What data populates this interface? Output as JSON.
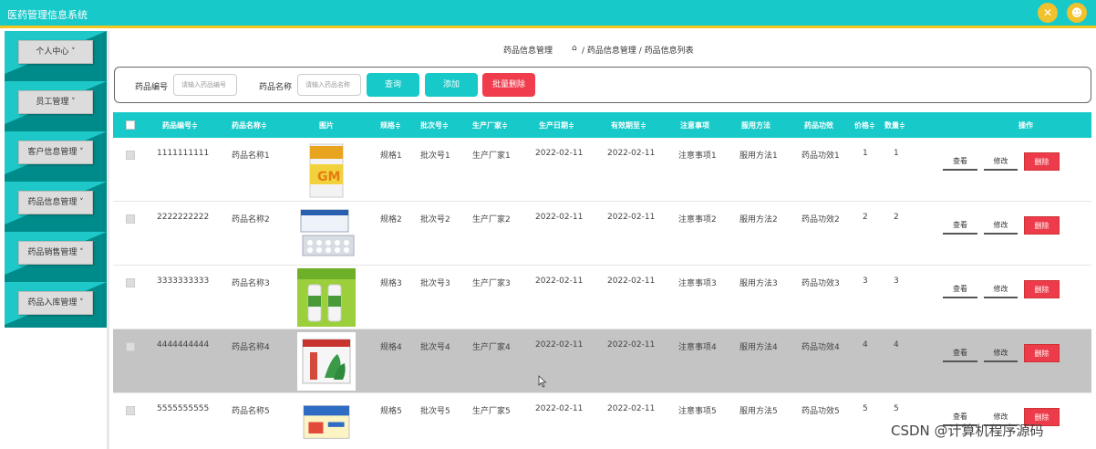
{
  "app": {
    "title": "医药管理信息系统"
  },
  "header_icons": [
    "fullscreen-icon",
    "user-icon"
  ],
  "sidebar": {
    "items": [
      {
        "label": "个人中心 ˅"
      },
      {
        "label": "员工管理 ˅"
      },
      {
        "label": "客户信息管理 ˅"
      },
      {
        "label": "药品信息管理 ˅"
      },
      {
        "label": "药品销售管理 ˅"
      },
      {
        "label": "药品入库管理 ˅"
      }
    ]
  },
  "breadcrumb": {
    "current": "药品信息管理",
    "path": "/ 药品信息管理 / 药品信息列表"
  },
  "search": {
    "code_label": "药品编号",
    "code_placeholder": "请输入药品编号",
    "name_label": "药品名称",
    "name_placeholder": "请输入药品名称",
    "query": "查询",
    "add": "添加",
    "batch_delete": "批量删除"
  },
  "colors": {
    "teal": "#17c9c9",
    "sidebar_dark": "#008b8b",
    "accent_yellow": "#f2c61d",
    "delete_red": "#ee3b4b"
  },
  "table": {
    "columns": [
      "药品编号≑",
      "药品名称≑",
      "图片",
      "规格≑",
      "批次号≑",
      "生产厂家≑",
      "生产日期≑",
      "有效期至≑",
      "注意事项",
      "服用方法",
      "药品功效",
      "价格≑",
      "数量≑",
      "操作"
    ],
    "actions": {
      "view": "查看",
      "edit": "修改",
      "delete": "删除"
    },
    "rows": [
      {
        "code": "1111111111",
        "name": "药品名称1",
        "spec": "规格1",
        "batch": "批次号1",
        "maker": "生产厂家1",
        "prod_date": "2022-02-11",
        "expire": "2022-02-11",
        "note": "注意事项1",
        "usage": "服用方法1",
        "effect": "药品功效1",
        "price": "1",
        "qty": "1"
      },
      {
        "code": "2222222222",
        "name": "药品名称2",
        "spec": "规格2",
        "batch": "批次号2",
        "maker": "生产厂家2",
        "prod_date": "2022-02-11",
        "expire": "2022-02-11",
        "note": "注意事项2",
        "usage": "服用方法2",
        "effect": "药品功效2",
        "price": "2",
        "qty": "2"
      },
      {
        "code": "3333333333",
        "name": "药品名称3",
        "spec": "规格3",
        "batch": "批次号3",
        "maker": "生产厂家3",
        "prod_date": "2022-02-11",
        "expire": "2022-02-11",
        "note": "注意事项3",
        "usage": "服用方法3",
        "effect": "药品功效3",
        "price": "3",
        "qty": "3"
      },
      {
        "code": "4444444444",
        "name": "药品名称4",
        "spec": "规格4",
        "batch": "批次号4",
        "maker": "生产厂家4",
        "prod_date": "2022-02-11",
        "expire": "2022-02-11",
        "note": "注意事项4",
        "usage": "服用方法4",
        "effect": "药品功效4",
        "price": "4",
        "qty": "4"
      },
      {
        "code": "5555555555",
        "name": "药品名称5",
        "spec": "规格5",
        "batch": "批次号5",
        "maker": "生产厂家5",
        "prod_date": "2022-02-11",
        "expire": "2022-02-11",
        "note": "注意事项5",
        "usage": "服用方法5",
        "effect": "药品功效5",
        "price": "5",
        "qty": "5"
      }
    ]
  },
  "watermark": "CSDN @计算机程序源码"
}
